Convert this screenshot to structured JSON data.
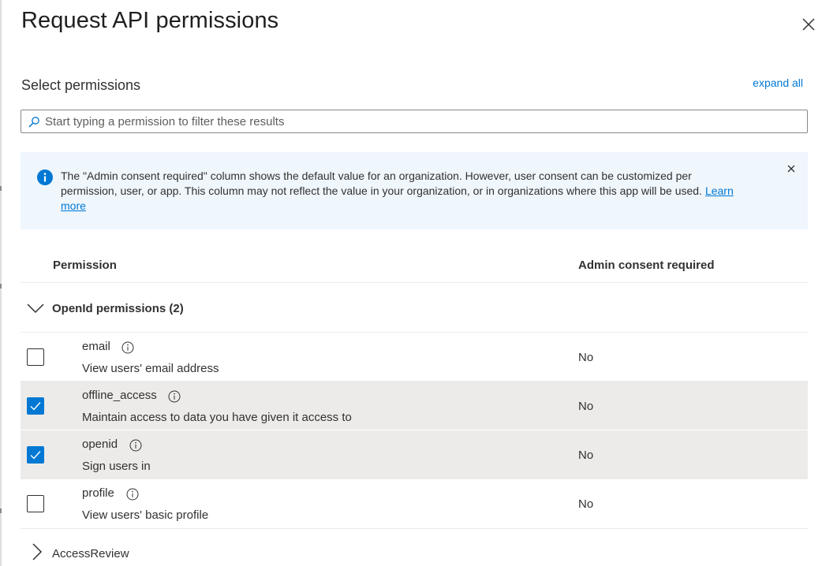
{
  "panel": {
    "title": "Request API permissions",
    "select_label": "Select permissions",
    "expand_all": "expand all"
  },
  "search": {
    "placeholder": "Start typing a permission to filter these results",
    "value": ""
  },
  "info": {
    "text": "The \"Admin consent required\" column shows the default value for an organization. However, user consent can be customized per permission, user, or app. This column may not reflect the value in your organization, or in organizations where this app will be used.",
    "link": "Learn more"
  },
  "table": {
    "columns": [
      "Permission",
      "Admin consent required"
    ]
  },
  "groups": [
    {
      "label": "OpenId permissions (2)",
      "expanded": true,
      "permissions": [
        {
          "name": "email",
          "description": "View users' email address",
          "admin_consent": "No",
          "checked": false
        },
        {
          "name": "offline_access",
          "description": "Maintain access to data you have given it access to",
          "admin_consent": "No",
          "checked": true
        },
        {
          "name": "openid",
          "description": "Sign users in",
          "admin_consent": "No",
          "checked": true
        },
        {
          "name": "profile",
          "description": "View users' basic profile",
          "admin_consent": "No",
          "checked": false
        }
      ]
    },
    {
      "label": "AccessReview",
      "expanded": false
    }
  ],
  "icons": {
    "close": "close-icon",
    "search": "search-icon",
    "info": "info-icon",
    "chevron_down": "chevron-down-icon",
    "chevron_right": "chevron-right-icon",
    "checkmark": "checkmark-icon"
  },
  "colors": {
    "accent": "#0078d4",
    "info_background": "#eff6fc",
    "selected_row": "#edebe9"
  }
}
